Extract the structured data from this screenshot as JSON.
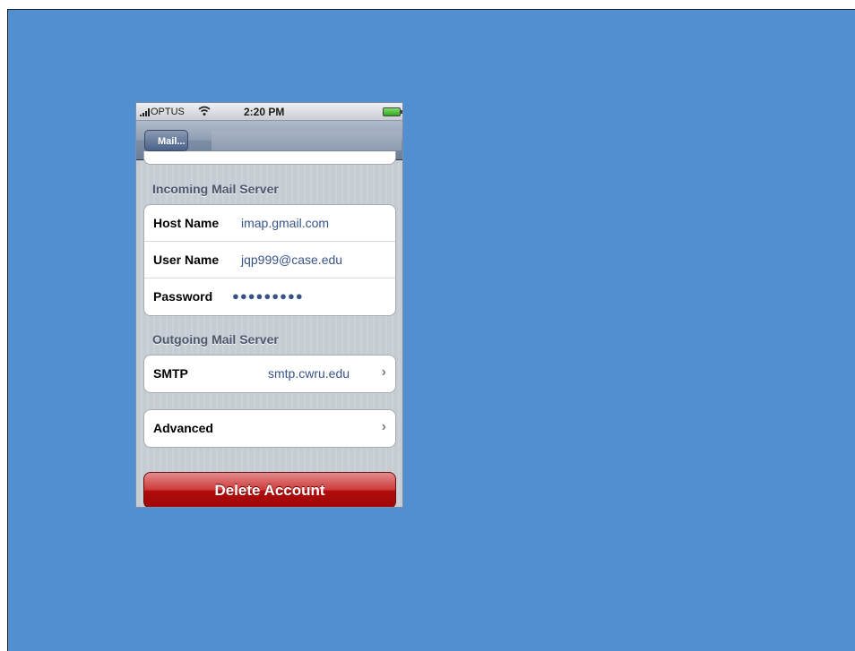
{
  "status_bar": {
    "carrier": "OPTUS",
    "time": "2:20 PM",
    "signal_icon": "signal-bars-icon",
    "wifi_icon": "wifi-icon",
    "battery_icon": "battery-icon"
  },
  "nav_bar": {
    "back_label": "Mail..."
  },
  "incoming": {
    "header": "Incoming Mail Server",
    "rows": [
      {
        "label": "Host Name",
        "value": "imap.gmail.com"
      },
      {
        "label": "User Name",
        "value": "jqp999@case.edu"
      },
      {
        "label": "Password",
        "value": "●●●●●●●●●"
      }
    ]
  },
  "outgoing": {
    "header": "Outgoing Mail Server",
    "smtp_label": "SMTP",
    "smtp_value": "smtp.cwru.edu"
  },
  "advanced": {
    "label": "Advanced"
  },
  "delete_button": {
    "label": "Delete Account"
  },
  "colors": {
    "background": "#528fd0",
    "value_text": "#385487",
    "delete_red": "#b00d0d"
  }
}
